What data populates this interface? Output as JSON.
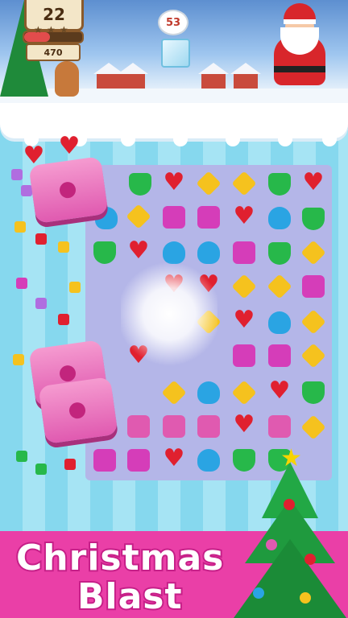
{
  "hud": {
    "moves_remaining": "22",
    "score": "470",
    "target_count": "53",
    "progress_fraction": 0.45
  },
  "banner": {
    "line1": "Christmas",
    "line2": "Blast"
  },
  "colors": {
    "banner_bg": "#ea3fa7",
    "pink_block": "#e05ab0",
    "heart": "#e0202f",
    "drop": "#2aa4e3",
    "gem": "#27b84a",
    "diamond": "#f5c21e",
    "cube": "#d53db9"
  },
  "icons": [
    "gingerbread-icon",
    "santa-icon",
    "ice-cube-icon",
    "christmas-tree-icon",
    "star-icon"
  ]
}
